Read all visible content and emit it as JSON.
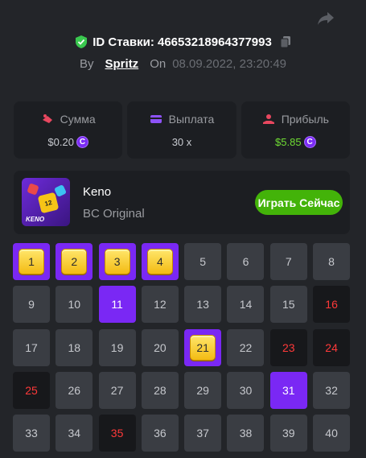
{
  "header": {
    "bet_id_label": "ID Ставки: 46653218964377993",
    "by_label": "By",
    "username": "Spritz",
    "on_label": "On",
    "datetime": "08.09.2022, 23:20:49"
  },
  "stats": [
    {
      "label": "Сумма",
      "value": "$0.20",
      "coin": true,
      "icon": "amount-icon",
      "color": "#e8475f"
    },
    {
      "label": "Выплата",
      "value": "30 x",
      "coin": false,
      "icon": "card-icon",
      "color": "#8d52f7"
    },
    {
      "label": "Прибыль",
      "value": "$5.85",
      "coin": true,
      "icon": "profit-icon",
      "color": "#e8475f"
    }
  ],
  "game": {
    "name": "Keno",
    "provider": "BC Original",
    "play_label": "Играть Сейчас",
    "thumb_number": "12",
    "thumb_logo": "KENO"
  },
  "coin_symbol": "C",
  "grid": {
    "numbers": [
      1,
      2,
      3,
      4,
      5,
      6,
      7,
      8,
      9,
      10,
      11,
      12,
      13,
      14,
      15,
      16,
      17,
      18,
      19,
      20,
      21,
      22,
      23,
      24,
      25,
      26,
      27,
      28,
      29,
      30,
      31,
      32,
      33,
      34,
      35,
      36,
      37,
      38,
      39,
      40
    ],
    "hits": [
      1,
      2,
      3,
      4,
      21
    ],
    "picked_no_hit": [
      11,
      31
    ],
    "drawn_no_pick": [
      16,
      23,
      24,
      25,
      35
    ]
  },
  "colors": {
    "accent": "#7a28f4",
    "play_button": "#43b309",
    "miss_text": "#ff3939",
    "verified": "#3ac84f"
  }
}
